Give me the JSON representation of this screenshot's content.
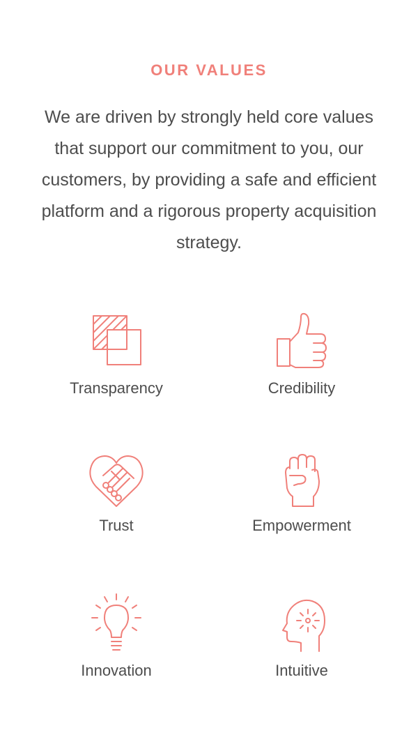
{
  "values_section": {
    "heading": "OUR VALUES",
    "intro": "We are driven by strongly held core values that support our commitment to you, our customers, by providing a safe and efficient platform and a rigorous property acquisition strategy.",
    "accent_color": "#f0807a",
    "text_color": "#4d4d4d",
    "items": [
      {
        "label": "Transparency",
        "icon": "overlapping-squares-icon"
      },
      {
        "label": "Credibility",
        "icon": "thumbs-up-icon"
      },
      {
        "label": "Trust",
        "icon": "handshake-heart-icon"
      },
      {
        "label": "Empowerment",
        "icon": "raised-fist-icon"
      },
      {
        "label": "Innovation",
        "icon": "lightbulb-icon"
      },
      {
        "label": "Intuitive",
        "icon": "head-idea-icon"
      }
    ]
  }
}
